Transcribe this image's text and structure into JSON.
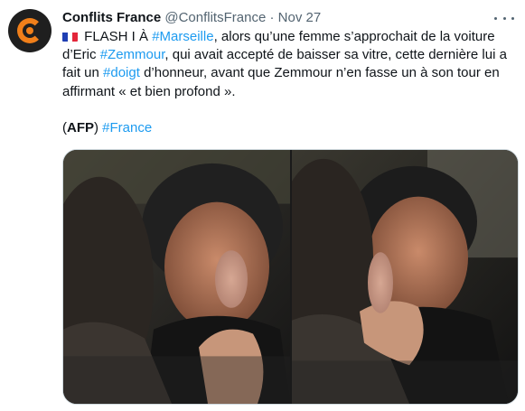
{
  "tweet": {
    "author_name": "Conflits France",
    "handle": "@ConflitsFrance",
    "separator": "·",
    "time": "Nov 27",
    "text": {
      "flag": "🇫🇷",
      "p1_a": " FLASH I À ",
      "hashtag_marseille": "#Marseille",
      "p1_b": ", alors qu’une femme s’approchait de la voiture d’Eric ",
      "hashtag_zemmour": "#Zemmour",
      "p1_c": ", qui avait accepté de baisser sa vitre, cette dernière lui a fait un ",
      "hashtag_doigt": "#doigt",
      "p1_d": " d’honneur, avant que Zemmour n’en fasse un à son tour en affirmant « et bien profond ».",
      "p2_a": "(",
      "p2_afp": "AFP",
      "p2_b": ") ",
      "hashtag_france": "#France"
    },
    "media": {
      "photo_count": 2
    }
  },
  "colors": {
    "link": "#1d9bf0",
    "secondary_text": "#536471",
    "avatar_bg": "#1f1f1f",
    "avatar_accent": "#f07f1a"
  },
  "icons": {
    "avatar": "conflits-france-logo",
    "more": "more-horizontal-icon"
  }
}
